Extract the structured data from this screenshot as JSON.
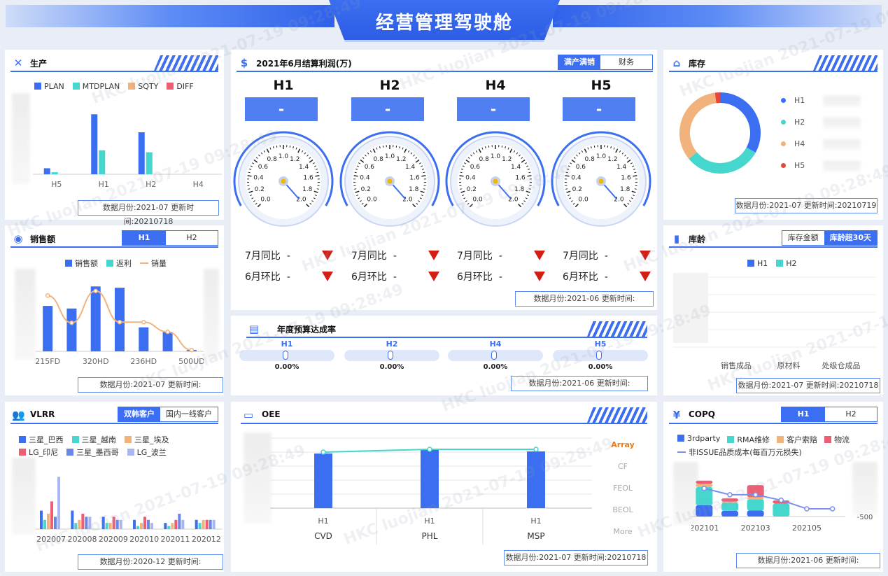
{
  "title": "经营管理驾驶舱",
  "watermark": "HKC luojian 2021-07-19 09:28:49",
  "production": {
    "title": "生产",
    "footer": "数据月份:2021-07  更新时间:20210718",
    "chart_data": {
      "type": "bar",
      "categories": [
        "H5",
        "H1",
        "H2",
        "H4"
      ],
      "series": [
        {
          "name": "PLAN",
          "color": "#3b6ef0",
          "values": [
            3,
            30,
            21,
            0
          ]
        },
        {
          "name": "MTDPLAN",
          "color": "#45d6cd",
          "values": [
            1,
            12,
            11,
            0
          ]
        },
        {
          "name": "SQTY",
          "color": "#f2b27c",
          "values": [
            0,
            0,
            0,
            0
          ]
        },
        {
          "name": "DIFF",
          "color": "#ef5d72",
          "values": [
            0,
            0,
            0,
            0
          ]
        }
      ],
      "ylim": [
        0,
        35
      ]
    }
  },
  "sales": {
    "title": "销售额",
    "tabs": [
      "H1",
      "H2"
    ],
    "footer": "数据月份:2021-07  更新时间:",
    "chart_data": {
      "type": "bar",
      "categories": [
        "215FD",
        "",
        "320HD",
        "",
        "236HD",
        "",
        "500UD"
      ],
      "series": [
        {
          "name": "销售额",
          "color": "#3b6ef0",
          "values": [
            70,
            66,
            100,
            98,
            37,
            30,
            2
          ]
        },
        {
          "name": "返利",
          "color": "#45d6cd",
          "values": [
            0,
            0,
            0,
            0,
            0,
            0,
            0
          ]
        },
        {
          "name": "销量",
          "color": "#f2b27c",
          "type": "line",
          "values": [
            86,
            44,
            93,
            45,
            45,
            30,
            2
          ]
        }
      ],
      "ylim": [
        0,
        110
      ]
    }
  },
  "vlrr": {
    "title": "VLRR",
    "tabs": [
      "双韩客户",
      "国内一线客户"
    ],
    "footer": "数据月份:2020-12  更新时间:",
    "chart_data": {
      "type": "bar",
      "categories": [
        "202007",
        "202008",
        "202009",
        "202010",
        "202011",
        "202012"
      ],
      "series": [
        {
          "name": "三星_巴西",
          "color": "#3b6ef0",
          "values": [
            6,
            6,
            4,
            3,
            2,
            3
          ]
        },
        {
          "name": "三星_越南",
          "color": "#45d6cd",
          "values": [
            3,
            2,
            2,
            1,
            1,
            2
          ]
        },
        {
          "name": "三星_埃及",
          "color": "#f2b27c",
          "values": [
            5,
            3,
            2,
            2,
            2,
            3
          ]
        },
        {
          "name": "LG_印尼",
          "color": "#ef5d72",
          "values": [
            9,
            5,
            4,
            4,
            3,
            3
          ]
        },
        {
          "name": "三星_墨西哥",
          "color": "#6b86e6",
          "values": [
            4,
            4,
            3,
            3,
            5,
            3
          ]
        },
        {
          "name": "LG_波兰",
          "color": "#a9b6f2",
          "values": [
            17,
            4,
            3,
            2,
            3,
            3
          ]
        }
      ],
      "ylim": [
        0,
        20
      ]
    }
  },
  "profit": {
    "title": "2021年6月结算利润(万)",
    "tabs": [
      "满产满销",
      "财务"
    ],
    "footer": "数据月份:2021-06 更新时间:",
    "units": [
      {
        "name": "H1",
        "value": "-"
      },
      {
        "name": "H2",
        "value": "-"
      },
      {
        "name": "H4",
        "value": "-"
      },
      {
        "name": "H5",
        "value": "-"
      }
    ],
    "gauge_ticks": [
      "0.0",
      "0.2",
      "0.4",
      "0.6",
      "0.8",
      "1.0",
      "1.2",
      "1.4",
      "1.6",
      "1.8",
      "2.0"
    ],
    "yoy_label": "7月同比",
    "mom_label": "6月环比",
    "cmp_value": "-",
    "tri_color": "#d21f16"
  },
  "budget": {
    "title": "年度预算达成率",
    "footer": "数据月份:2021-06 更新时间:",
    "items": [
      {
        "name": "H1",
        "value": "0.00%"
      },
      {
        "name": "H2",
        "value": "0.00%"
      },
      {
        "name": "H4",
        "value": "0.00%"
      },
      {
        "name": "H5",
        "value": "0.00%"
      }
    ]
  },
  "oee": {
    "title": "OEE",
    "footer": "数据月份:2021-07  更新时间:20210718",
    "menu": [
      "Array",
      "CF",
      "FEOL",
      "BEOL",
      "More"
    ],
    "chart_data": {
      "type": "bar",
      "categories": [
        "H1",
        "H1",
        "H1"
      ],
      "groups": [
        "CVD",
        "PHL",
        "MSP"
      ],
      "series": [
        {
          "name": "bar",
          "color": "#3b6ef0",
          "values": [
            78,
            83,
            81
          ]
        },
        {
          "name": "line",
          "color": "#45d6cd",
          "type": "line",
          "values": [
            80,
            84,
            84
          ]
        }
      ],
      "ylim": [
        0,
        100
      ]
    }
  },
  "inventory": {
    "title": "库存",
    "footer": "数据月份:2021-07  更新时间:20210719",
    "chart_data": {
      "type": "pie",
      "labels": [
        "H1",
        "H2",
        "H4",
        "H5"
      ],
      "colors": [
        "#3b6ef0",
        "#45d6cd",
        "#f2b27c",
        "#e8463c"
      ],
      "values": [
        33,
        31,
        34,
        2
      ]
    }
  },
  "age": {
    "title": "库龄",
    "tabs": [
      "库存金额",
      "库龄超30天"
    ],
    "footer": "数据月份:2021-07  更新时间:20210718",
    "chart_data": {
      "type": "bar",
      "categories": [
        "销售成品",
        "原材料",
        "处级仓成品"
      ],
      "series": [
        {
          "name": "H1",
          "color": "#3b6ef0",
          "values": [
            0,
            0,
            0
          ]
        },
        {
          "name": "H2",
          "color": "#45d6cd",
          "values": [
            0,
            0,
            0
          ]
        }
      ]
    }
  },
  "copq": {
    "title": "COPQ",
    "tabs": [
      "H1",
      "H2"
    ],
    "footer": "数据月份:2021-06  更新时间:",
    "yaxis": [
      "0",
      "-500"
    ],
    "chart_data": {
      "type": "bar",
      "categories": [
        "202101",
        "",
        "202103",
        "",
        "202105",
        ""
      ],
      "series": [
        {
          "name": "3rdparty",
          "color": "#3b6ef0",
          "values": [
            28,
            14,
            15,
            0,
            0,
            0
          ]
        },
        {
          "name": "RMA维修",
          "color": "#45d6cd",
          "values": [
            45,
            20,
            28,
            32,
            0,
            0
          ]
        },
        {
          "name": "客户索赔",
          "color": "#f2b27c",
          "values": [
            8,
            3,
            5,
            0,
            0,
            0
          ]
        },
        {
          "name": "物流",
          "color": "#ef5d72",
          "values": [
            8,
            8,
            30,
            8,
            0,
            0
          ]
        },
        {
          "name": "非ISSUE品质成本(每百万元损失)",
          "color": "#7c8ff0",
          "type": "line",
          "values": [
            62,
            48,
            48,
            36,
            17,
            17
          ]
        }
      ],
      "ylim": [
        0,
        100
      ]
    }
  }
}
